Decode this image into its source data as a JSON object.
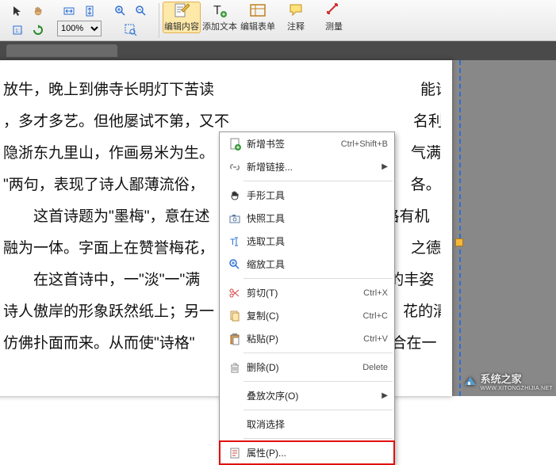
{
  "toolbar": {
    "zoom_value": "100%",
    "edit_content": "编辑内容",
    "add_text": "添加文本",
    "edit_form": "编辑表单",
    "annotate": "注释",
    "measure": "测量"
  },
  "document": {
    "lines": [
      "放牛，晚上到佛寺长明灯下苦读",
      "，多才多艺。但他屡试不第，又不",
      "隐浙东九里山，作画易米为生。",
      "\"两句，表现了诗人鄙薄流俗，",
      "　　这首诗题为\"墨梅\"，意在述",
      "融为一体。字面上在赞誉梅花，",
      "　　在这首诗中，一\"淡\"一\"满",
      "诗人傲岸的形象跃然纸上；另一",
      "仿佛扑面而来。从而使\"诗格\""
    ],
    "tail": [
      "能诗善",
      "名利禄，",
      "气满乾",
      "各。",
      "格有机",
      "之德。",
      "的丰姿",
      "花的清",
      "合在一"
    ]
  },
  "context_menu": {
    "new_bookmark": "新增书签",
    "new_bookmark_sc": "Ctrl+Shift+B",
    "new_link": "新增链接...",
    "hand_tool": "手形工具",
    "snapshot_tool": "快照工具",
    "select_tool": "选取工具",
    "zoom_tool": "缩放工具",
    "cut": "剪切(T)",
    "cut_sc": "Ctrl+X",
    "copy": "复制(C)",
    "copy_sc": "Ctrl+C",
    "paste": "粘贴(P)",
    "paste_sc": "Ctrl+V",
    "delete": "删除(D)",
    "delete_sc": "Delete",
    "stack_order": "叠放次序(O)",
    "deselect": "取消选择",
    "properties": "属性(P)..."
  },
  "watermark": {
    "text": "系统之家",
    "url": "WWW.XITONGZHIJIA.NET"
  }
}
